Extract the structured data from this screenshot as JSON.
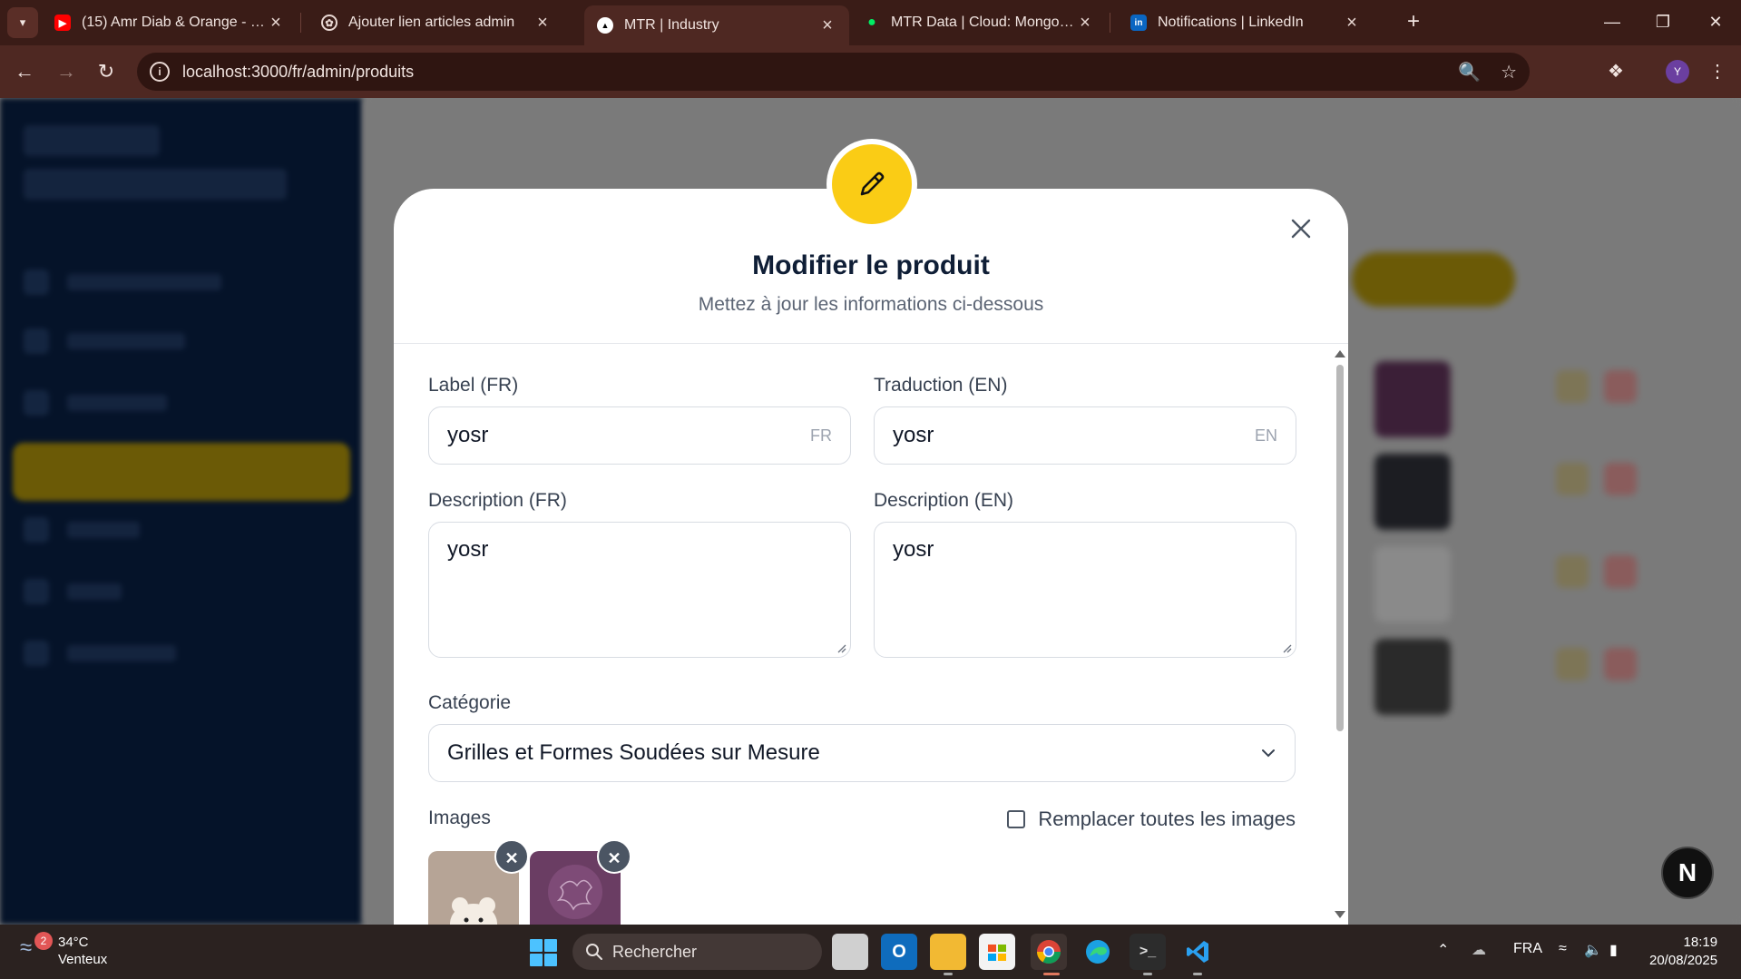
{
  "browser": {
    "tabs": [
      {
        "title": "(15) Amr Diab & Orange - Khat",
        "icon": "youtube-icon"
      },
      {
        "title": "Ajouter lien articles admin",
        "icon": "chatgpt-icon"
      },
      {
        "title": "MTR | Industry",
        "icon": "vercel-icon"
      },
      {
        "title": "MTR Data | Cloud: MongoDB Cl",
        "icon": "mongodb-icon"
      },
      {
        "title": "Notifications | LinkedIn",
        "icon": "linkedin-icon"
      }
    ],
    "url": "localhost:3000/fr/admin/produits",
    "profile_initial": "Y"
  },
  "modal": {
    "title": "Modifier le produit",
    "subtitle": "Mettez à jour les informations ci-dessous",
    "fields": {
      "label_fr": {
        "label": "Label (FR)",
        "value": "yosr",
        "suffix": "FR"
      },
      "label_en": {
        "label": "Traduction (EN)",
        "value": "yosr",
        "suffix": "EN"
      },
      "desc_fr": {
        "label": "Description (FR)",
        "value": "yosr"
      },
      "desc_en": {
        "label": "Description (EN)",
        "value": "yosr"
      },
      "category": {
        "label": "Catégorie",
        "value": "Grilles et Formes Soudées sur Mesure"
      },
      "images": {
        "label": "Images",
        "replace_label": "Remplacer toutes les images",
        "replace_checked": false
      }
    },
    "accent_color": "#facc15"
  },
  "overlay_badge": "N",
  "taskbar": {
    "weather_temp": "34°C",
    "weather_desc": "Venteux",
    "weather_badge": "2",
    "search_placeholder": "Rechercher",
    "language": "FRA",
    "time": "18:19",
    "date": "20/08/2025"
  }
}
